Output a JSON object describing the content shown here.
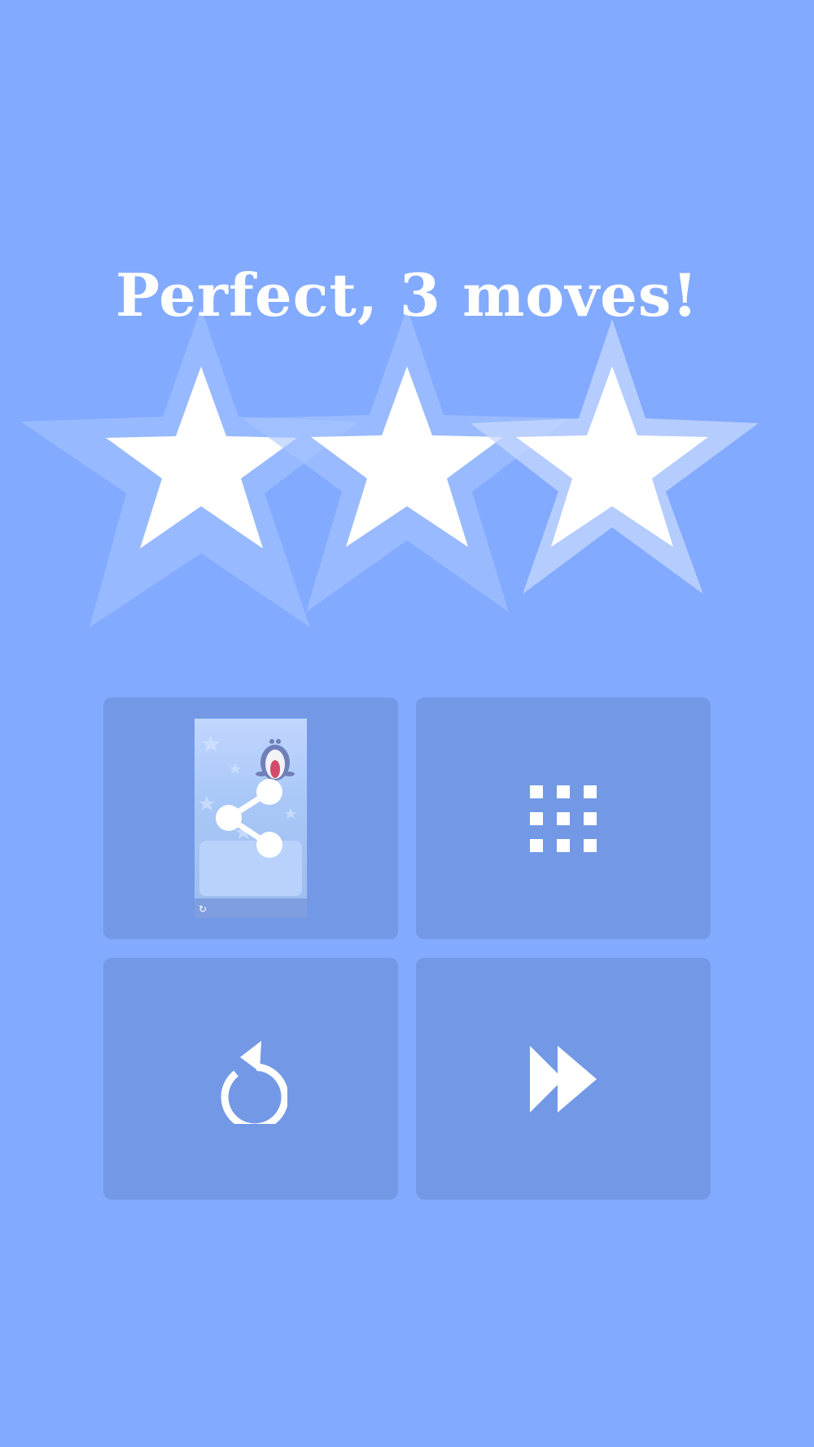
{
  "result": {
    "title": "Perfect, 3 moves!",
    "stars_earned": 3,
    "stars_total": 3
  },
  "actions": [
    {
      "name": "share",
      "icon": "share-icon"
    },
    {
      "name": "levels",
      "icon": "grid-icon"
    },
    {
      "name": "restart",
      "icon": "restart-icon"
    },
    {
      "name": "skip",
      "icon": "fast-forward-icon"
    }
  ],
  "colors": {
    "background": "#82aaff",
    "tile": "#7399e6",
    "star_fill": "#ffffff",
    "star_glow": "#a9c4ff"
  }
}
